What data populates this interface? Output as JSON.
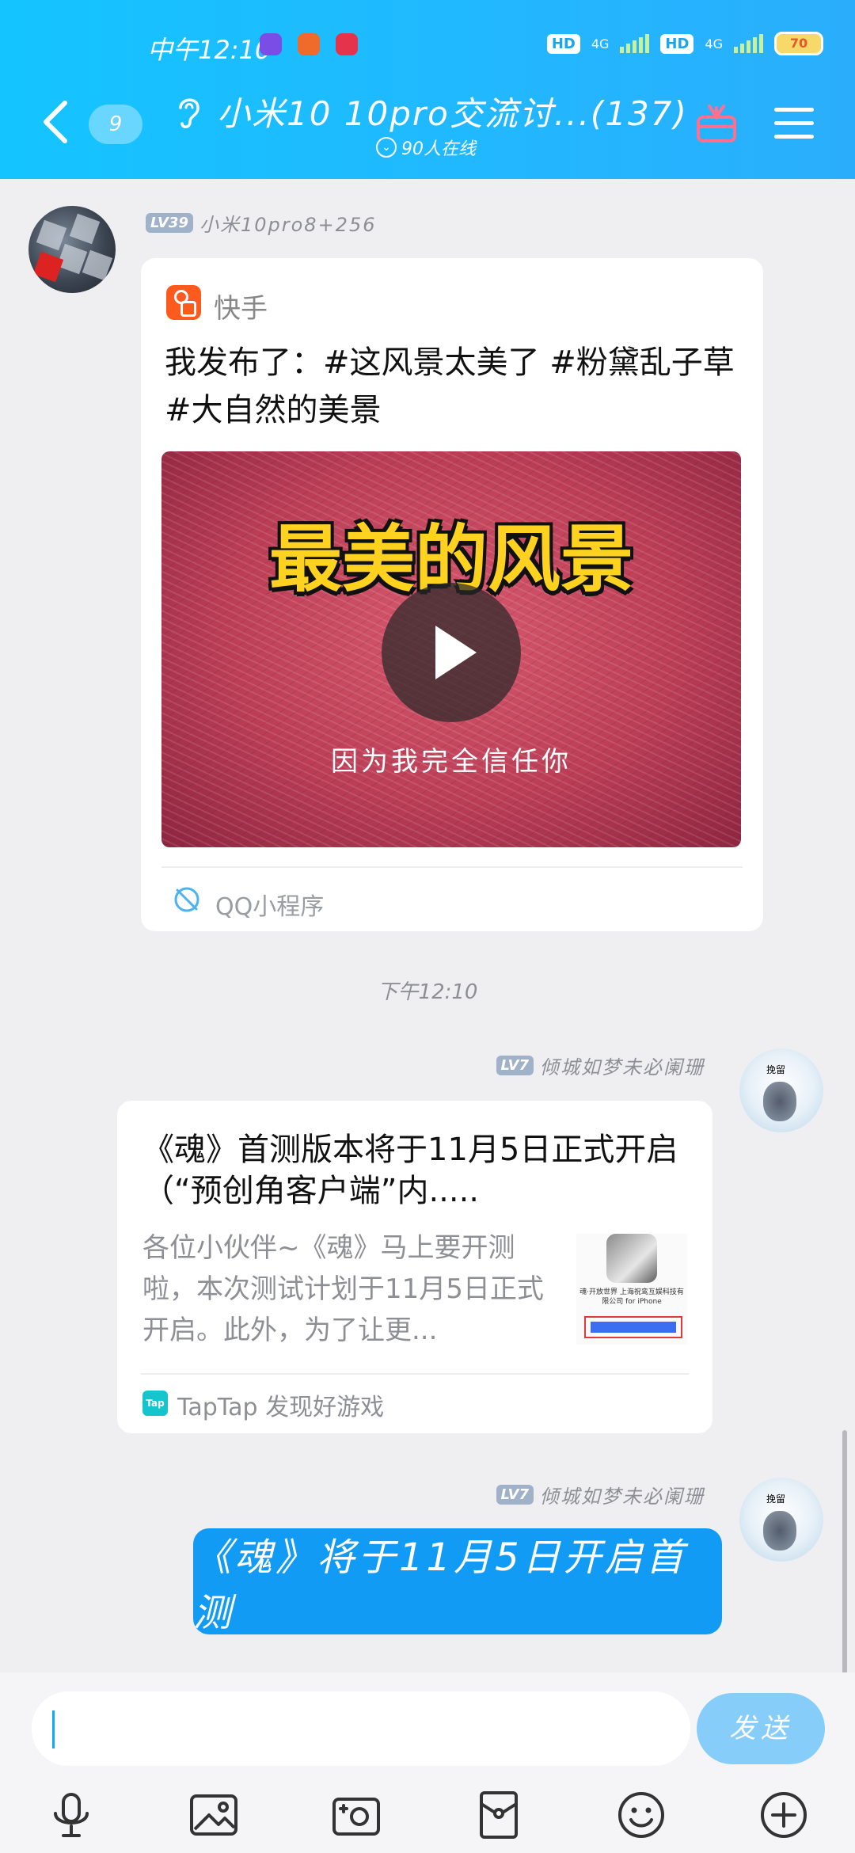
{
  "status_bar": {
    "time": "中午12:10",
    "hd1": "HD",
    "sig1": "4G",
    "hd2": "HD",
    "sig2": "4G",
    "battery": "70"
  },
  "header": {
    "unread_count": "9",
    "title": "小米10 10pro交流讨...(137)",
    "online": "90人在线"
  },
  "messages": [
    {
      "level": "LV39",
      "nickname": "小米10pro8+256",
      "app_name": "快手",
      "title": "我发布了：#这风景太美了 #粉黛乱子草 #大自然的美景",
      "video_headline": "最美的风景",
      "video_caption": "因为我完全信任你",
      "source": "QQ小程序"
    },
    {
      "timestamp": "下午12:10"
    },
    {
      "level": "LV7",
      "nickname": "倾城如梦未必阑珊",
      "title": "《魂》首测版本将于11月5日正式开启（“预创角客户端”内.....",
      "description": "各位小伙伴~《魂》马上要开测啦，本次测试计划于11月5日正式开启。此外，为了让更...",
      "thumb_text": "魂·开放世界 上海祝鸾互娱科技有限公司 for iPhone",
      "source": "TapTap 发现好游戏",
      "source_icon": "Tap"
    },
    {
      "level": "LV7",
      "nickname": "倾城如梦未必阑珊",
      "text": "《魂》将于11月5日开启首测"
    }
  ],
  "avatar_tag": "挽留",
  "input": {
    "value": "",
    "send_label": "发送"
  },
  "toolbar": [
    "voice-icon",
    "picture-icon",
    "camera-icon",
    "red-packet-icon",
    "emoji-icon",
    "plus-icon"
  ],
  "colors": {
    "header": "#1bbdff",
    "bubble": "#129bf5",
    "send": "#86cdfa"
  }
}
